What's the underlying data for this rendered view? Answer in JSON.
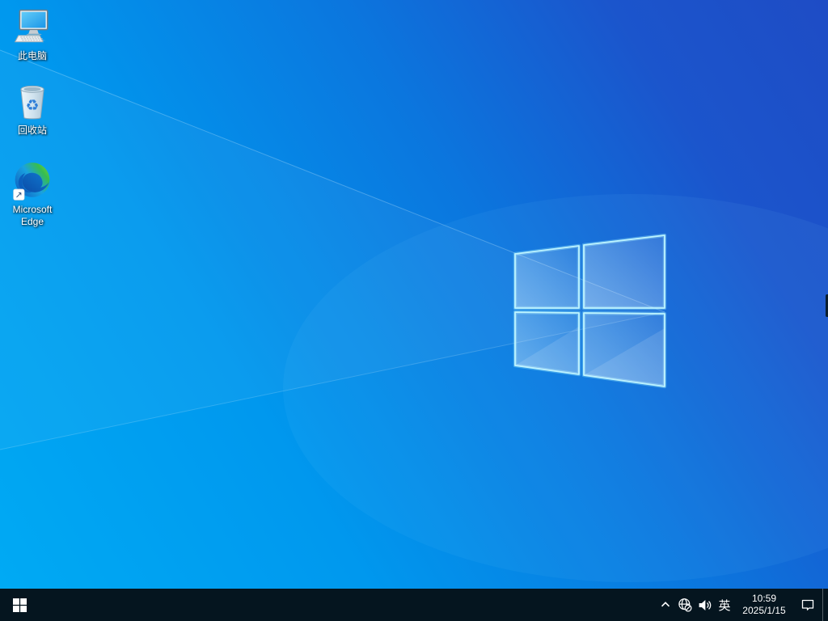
{
  "desktop": {
    "icons": [
      {
        "id": "this-pc",
        "label": "此电脑",
        "icon": "computer-monitor-icon"
      },
      {
        "id": "recycle-bin",
        "label": "回收站",
        "icon": "recycle-bin-icon"
      },
      {
        "id": "microsoft-edge",
        "label": "Microsoft Edge",
        "icon": "edge-browser-icon"
      }
    ]
  },
  "taskbar": {
    "start_icon": "windows-logo-icon",
    "tray": {
      "hidden_icons": "chevron-up-icon",
      "network_icon": "globe-no-internet-icon",
      "volume_icon": "speaker-icon",
      "ime": "英",
      "time": "10:59",
      "date": "2025/1/15",
      "action_center_icon": "notification-bubble-icon"
    }
  },
  "colors": {
    "taskbar_background": "#05151f",
    "wallpaper_bright": "#00abf4",
    "wallpaper_deep": "#1e4cc5",
    "logo_edge_glow": "#bdf4ff",
    "icon_label_text": "#ffffff"
  }
}
